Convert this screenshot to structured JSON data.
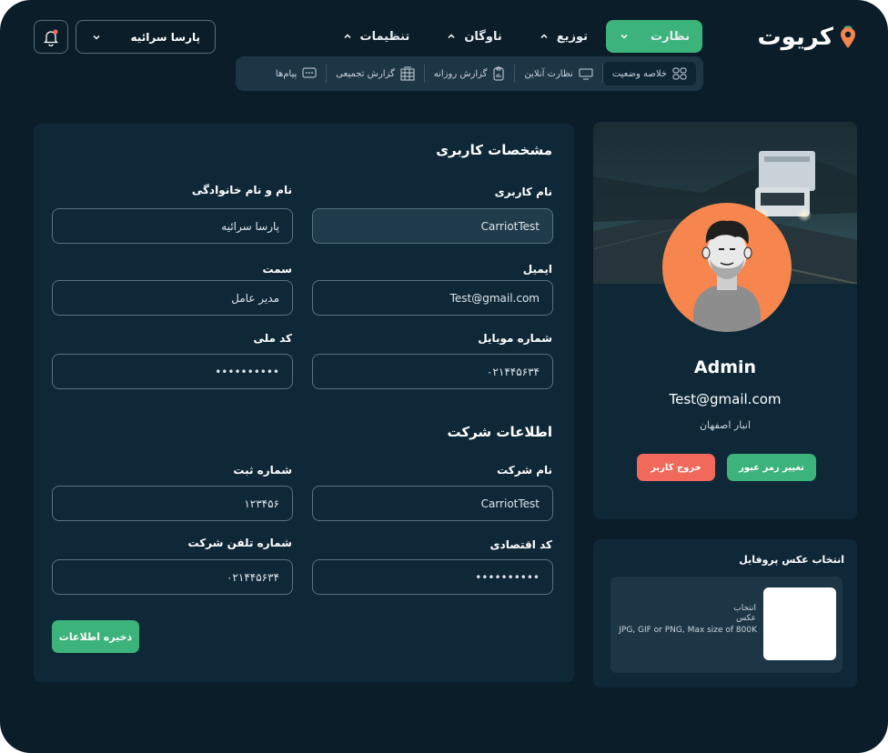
{
  "logo": {
    "text": "کریوت"
  },
  "nav": {
    "items": [
      {
        "label": "نظارت",
        "active": true
      },
      {
        "label": "توزیع"
      },
      {
        "label": "ناوگان"
      },
      {
        "label": "تنظیمات"
      }
    ]
  },
  "subnav": {
    "items": [
      {
        "label": "خلاصه وضعیت",
        "icon": "dashboard-icon",
        "active": true
      },
      {
        "label": "نظارت آنلاین",
        "icon": "monitor-icon"
      },
      {
        "label": "گزارش روزانه",
        "icon": "clipboard-icon"
      },
      {
        "label": "گزارش تجمیعی",
        "icon": "grid-report-icon"
      },
      {
        "label": "پیام‌ها",
        "icon": "message-icon"
      }
    ]
  },
  "header": {
    "user_select": "پارسا سرائیه"
  },
  "user_info": {
    "title": "مشخصات کاربری",
    "username_label": "نام کاربری",
    "username": "CarriotTest",
    "fullname_label": "نام و نام خانوادگی",
    "fullname": "پارسا سرائیه",
    "email_label": "ایمیل",
    "email": "Test@gmail.com",
    "position_label": "سمت",
    "position": "مدیر عامل",
    "mobile_label": "شماره موبایل",
    "mobile": "۰۲۱۴۴۵۶۳۴",
    "national_label": "کد ملی",
    "national": "••••••••••"
  },
  "company_info": {
    "title": "اطلاعات شرکت",
    "name_label": "نام شرکت",
    "name": "CarriotTest",
    "reg_label": "شماره ثبت",
    "reg": "۱۲۳۴۵۶",
    "econ_label": "کد اقتصادی",
    "econ": "••••••••••",
    "phone_label": "شماره تلفن شرکت",
    "phone": "۰۲۱۴۴۵۶۳۴"
  },
  "save_label": "ذخیره اطلاعات",
  "profile": {
    "name": "Admin",
    "email": "Test@gmail.com",
    "role": "انبار اصفهان",
    "change_password": "تغییر رمز عبور",
    "logout": "خروج کاربر"
  },
  "upload": {
    "title": "انتخاب عکس پروفایل",
    "line1": "انتخاب",
    "line2": "عکس",
    "hint": "JPG, GIF or PNG, Max size of 800K"
  },
  "colors": {
    "accent": "#3bb37a",
    "danger": "#f0695a",
    "avatar_bg": "#f6864e",
    "background": "#0a1d29",
    "card": "#0f2838"
  }
}
